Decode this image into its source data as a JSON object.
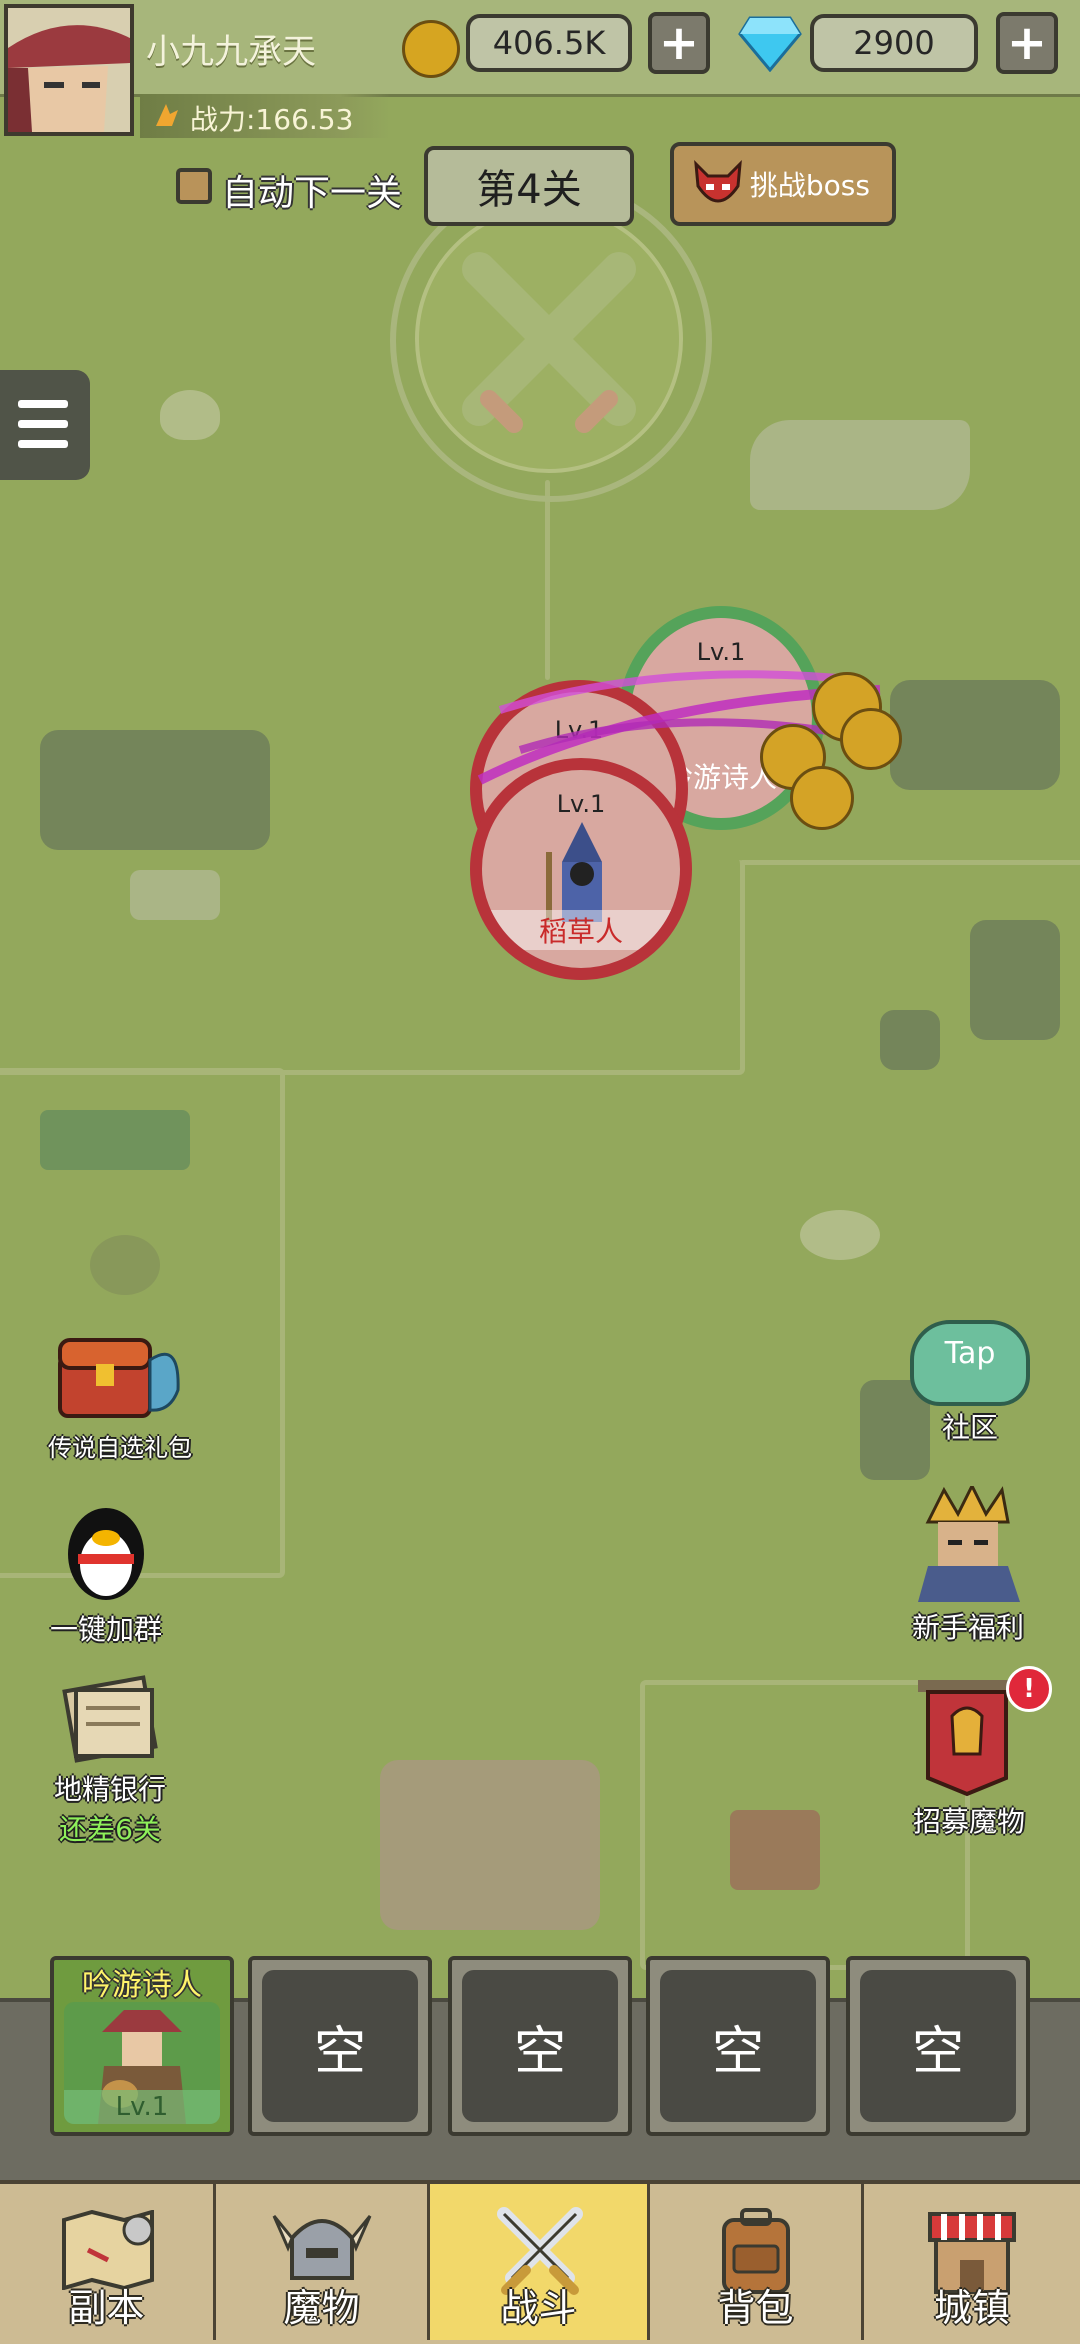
{
  "player": {
    "name": "小九九承天",
    "power_label": "战力:166.53"
  },
  "resources": {
    "gold": "406.5K",
    "gems": "2900",
    "add_symbol": "+"
  },
  "controls": {
    "auto_next_label": "自动下一关",
    "auto_next_checked": false,
    "stage_label": "第4关",
    "boss_button_label": "挑战boss"
  },
  "left_side": [
    {
      "label": "传说自选礼包"
    },
    {
      "label": "一键加群"
    },
    {
      "label": "地精银行",
      "sub": "还差6关"
    }
  ],
  "right_side": [
    {
      "label": "社区",
      "badge_text": "Tap"
    },
    {
      "label": "新手福利"
    },
    {
      "label": "招募魔物",
      "alert": "!"
    }
  ],
  "battle_units": [
    {
      "level": "Lv.1",
      "name": "吟游诗人",
      "ring": "#55a35a"
    },
    {
      "level": "Lv.1",
      "name": "",
      "ring": "#b8333a"
    },
    {
      "level": "Lv.1",
      "name": "稻草人",
      "ring": "#b8333a"
    }
  ],
  "team_slots": [
    {
      "name": "吟游诗人",
      "level": "Lv.1",
      "filled": true
    },
    {
      "label": "空"
    },
    {
      "label": "空"
    },
    {
      "label": "空"
    },
    {
      "label": "空"
    }
  ],
  "bottom_nav": [
    {
      "label": "副本",
      "active": false
    },
    {
      "label": "魔物",
      "active": false
    },
    {
      "label": "战斗",
      "active": true
    },
    {
      "label": "背包",
      "active": false
    },
    {
      "label": "城镇",
      "active": false
    }
  ],
  "colors": {
    "map": "#93a85c",
    "nav_active": "#f2d86a",
    "hostile_ring": "#b8333a",
    "friendly_ring": "#55a35a"
  }
}
